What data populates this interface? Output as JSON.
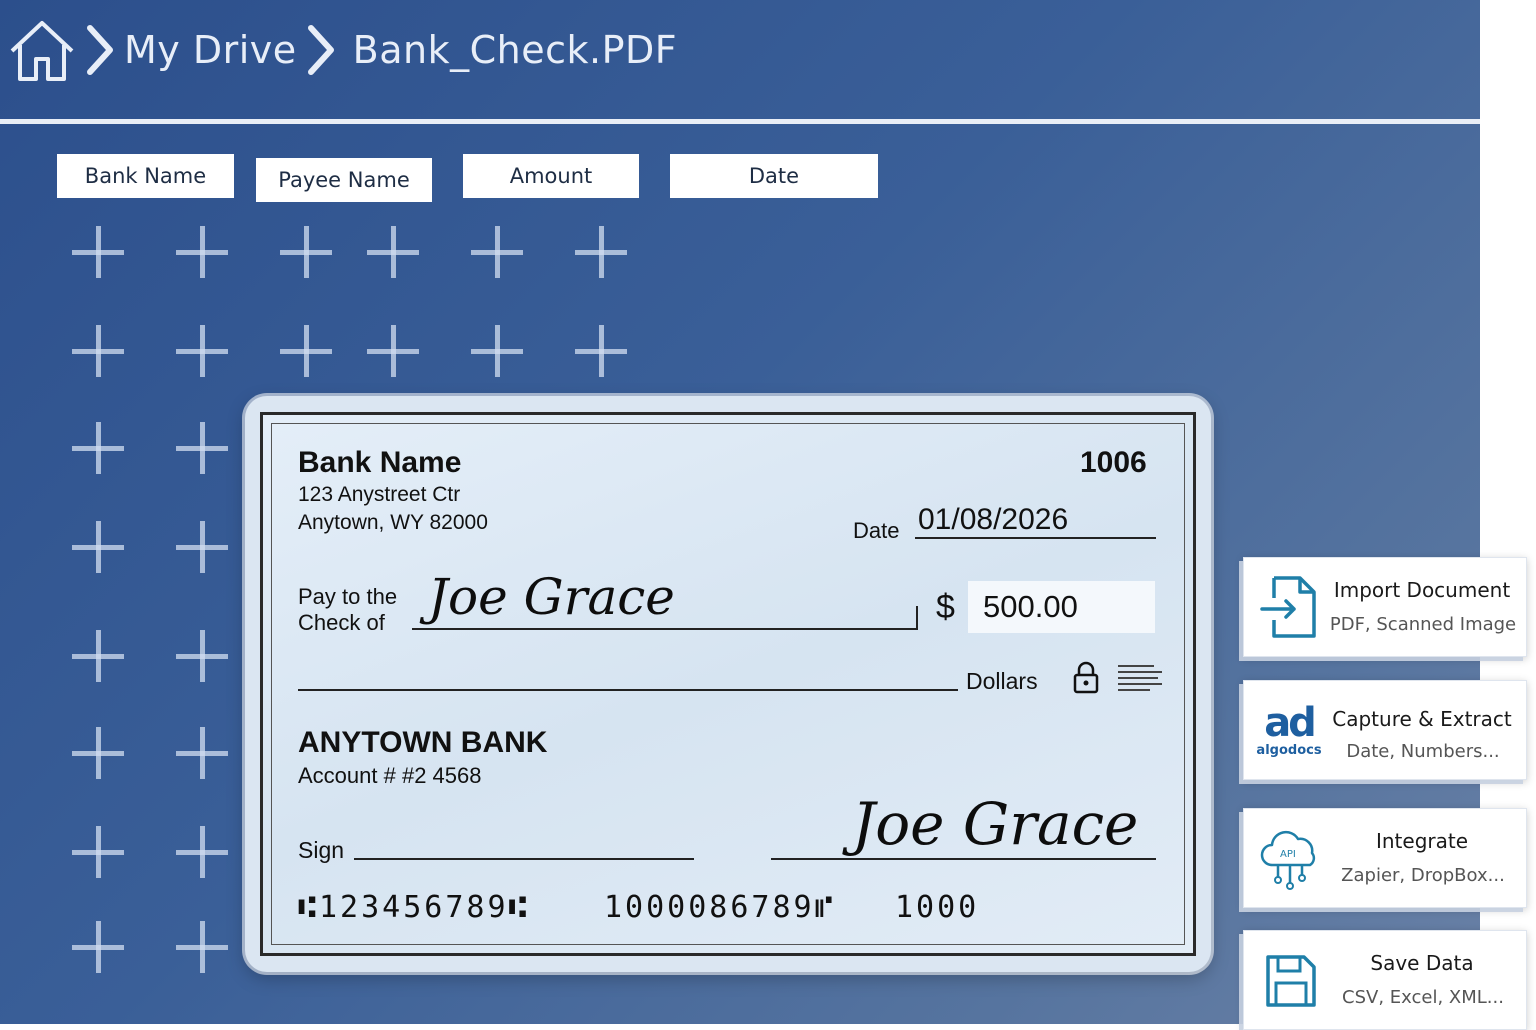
{
  "breadcrumb": {
    "home_icon": "home-icon",
    "items": [
      "My Drive",
      "Bank_Check.PDF"
    ]
  },
  "fields": [
    "Bank Name",
    "Payee Name",
    "Amount",
    "Date"
  ],
  "check": {
    "bank_name": "Bank Name",
    "address_line1": "123 Anystreet Ctr",
    "address_line2": "Anytown, WY 82000",
    "check_number": "1006",
    "date_label": "Date",
    "date_value": "01/08/2026",
    "pay_to_line1": "Pay to the",
    "pay_to_line2": "Check of",
    "payee": "Joe Grace",
    "currency": "$",
    "amount": "500.00",
    "dollars_label": "Dollars",
    "bank": "ANYTOWN BANK",
    "account": "Account # #2 4568",
    "sign_label": "Sign",
    "signature": "Joe Grace",
    "micr_routing": "⑆123456789⑆",
    "micr_account": "1000086789⑈",
    "micr_check": "1000"
  },
  "actions": [
    {
      "title": "Import Document",
      "subtitle": "PDF, Scanned Image",
      "icon": "import-document-icon"
    },
    {
      "title": "Capture & Extract",
      "subtitle": "Date, Numbers...",
      "icon": "algodocs-logo",
      "logo_big": "ad",
      "logo_small": "algodocs"
    },
    {
      "title": "Integrate",
      "subtitle": "Zapier, DropBox...",
      "icon": "cloud-api-icon",
      "cloud_text": "API"
    },
    {
      "title": "Save Data",
      "subtitle": "CSV, Excel, XML...",
      "icon": "save-floppy-icon"
    }
  ],
  "colors": {
    "background": "#2c4f8c",
    "accent": "#1f6fa8",
    "card": "#ffffff"
  }
}
